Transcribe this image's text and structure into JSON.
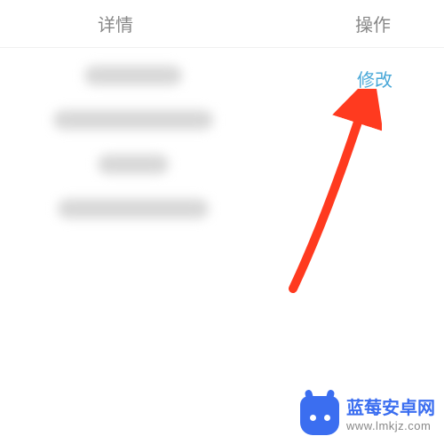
{
  "header": {
    "details_label": "详情",
    "action_label": "操作"
  },
  "action": {
    "modify_label": "修改"
  },
  "watermark": {
    "title": "蓝莓安卓网",
    "url": "www.lmkjz.com"
  },
  "arrow_color": "#ff3a1f"
}
